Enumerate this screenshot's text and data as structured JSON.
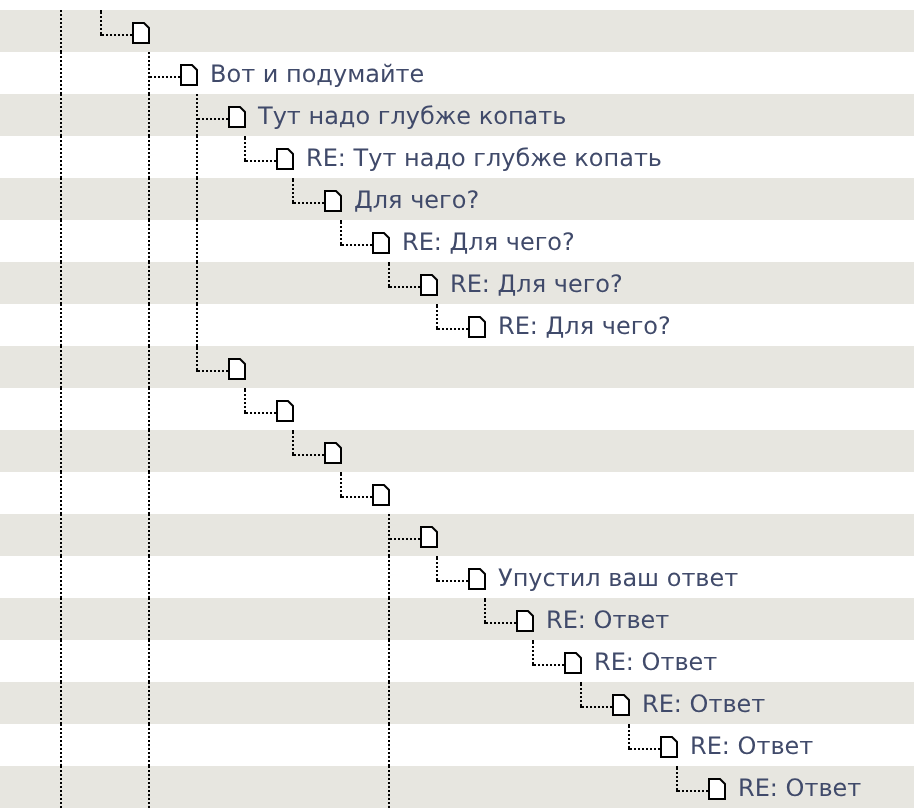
{
  "tree": {
    "more_below": true,
    "children": [
      {
        "more_below": false,
        "children": [
          {
            "title": "Вот и подумайте",
            "more_below": true,
            "children": [
              {
                "title": "Тут надо глубже копать",
                "children": [
                  {
                    "title": "RE: Тут надо глубже копать",
                    "children": [
                      {
                        "title": "Для чего?",
                        "children": [
                          {
                            "title": "RE: Для чего?",
                            "children": [
                              {
                                "title": "RE: Для чего?",
                                "children": [
                                  {
                                    "title": "RE: Для чего?"
                                  }
                                ]
                              }
                            ]
                          }
                        ]
                      }
                    ]
                  }
                ]
              },
              {
                "children": [
                  {
                    "children": [
                      {
                        "children": [
                          {
                            "children": [
                              {
                                "more_below": true,
                                "children": [
                                  {
                                    "title": "Упустил ваш ответ",
                                    "children": [
                                      {
                                        "title": "RE: Ответ",
                                        "children": [
                                          {
                                            "title": "RE: Ответ",
                                            "children": [
                                              {
                                                "title": "RE: Ответ",
                                                "children": [
                                                  {
                                                    "title": "RE: Ответ",
                                                    "children": [
                                                      {
                                                        "title": "RE: Ответ"
                                                      }
                                                    ]
                                                  }
                                                ]
                                              }
                                            ]
                                          }
                                        ]
                                      }
                                    ]
                                  }
                                ]
                              }
                            ]
                          }
                        ]
                      }
                    ]
                  }
                ]
              }
            ]
          }
        ]
      }
    ]
  }
}
